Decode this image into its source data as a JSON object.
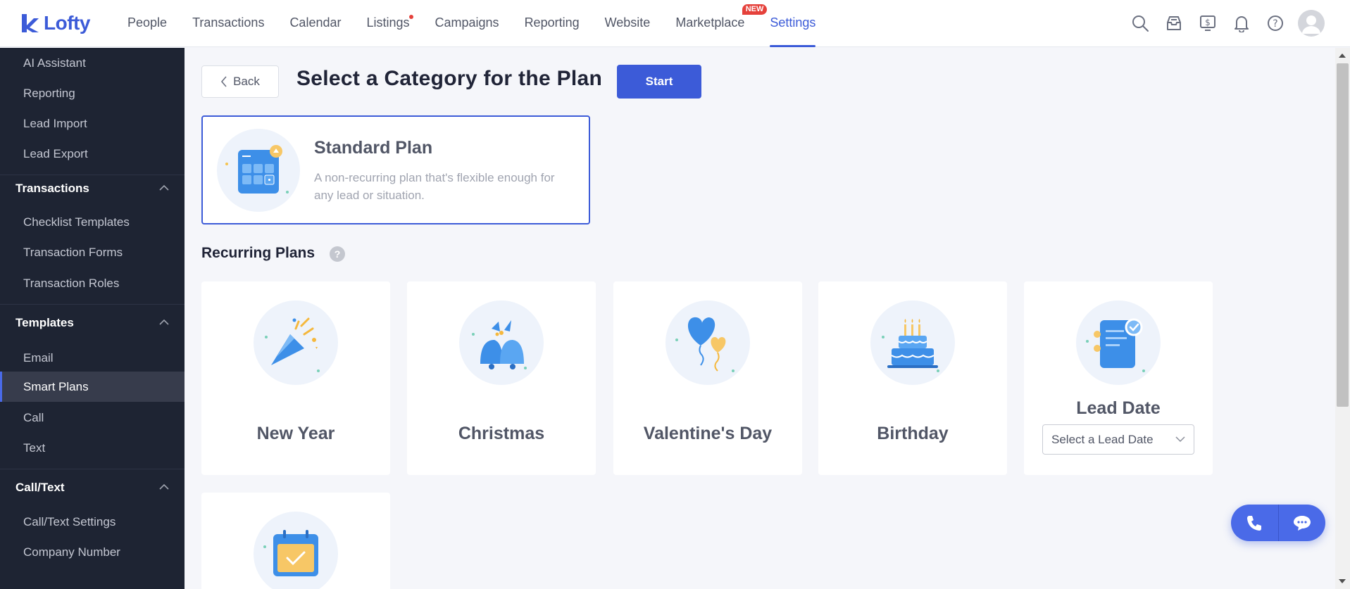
{
  "brand": {
    "name": "Lofty",
    "accent": "#3c5bd8"
  },
  "nav": {
    "items": [
      {
        "label": "People",
        "active": false
      },
      {
        "label": "Transactions",
        "active": false
      },
      {
        "label": "Calendar",
        "active": false
      },
      {
        "label": "Listings",
        "active": false,
        "dot": true
      },
      {
        "label": "Campaigns",
        "active": false
      },
      {
        "label": "Reporting",
        "active": false
      },
      {
        "label": "Website",
        "active": false
      },
      {
        "label": "Marketplace",
        "active": false,
        "badge": "NEW"
      },
      {
        "label": "Settings",
        "active": true
      }
    ],
    "icons": [
      "search-icon",
      "inbox-icon",
      "billing-icon",
      "bell-icon",
      "help-icon",
      "avatar"
    ]
  },
  "sidebar": {
    "items_top": [
      "AI Assistant",
      "Reporting",
      "Lead Import",
      "Lead Export"
    ],
    "transactions": {
      "title": "Transactions",
      "items": [
        "Checklist Templates",
        "Transaction Forms",
        "Transaction Roles"
      ]
    },
    "templates": {
      "title": "Templates",
      "items": [
        "Email",
        "Smart Plans",
        "Call",
        "Text"
      ],
      "active": "Smart Plans"
    },
    "calltext": {
      "title": "Call/Text",
      "items": [
        "Call/Text Settings",
        "Company Number"
      ]
    }
  },
  "main": {
    "back_label": "Back",
    "title": "Select a Category for the Plan",
    "start_label": "Start",
    "standard": {
      "title": "Standard Plan",
      "description": "A non-recurring plan that's flexible enough for any lead or situation."
    },
    "recurring_title": "Recurring Plans",
    "help_glyph": "?",
    "recurring": [
      {
        "label": "New Year",
        "icon": "party-popper-icon"
      },
      {
        "label": "Christmas",
        "icon": "christmas-bells-icon"
      },
      {
        "label": "Valentine's Day",
        "icon": "heart-balloons-icon"
      },
      {
        "label": "Birthday",
        "icon": "birthday-cake-icon"
      },
      {
        "label": "Lead Date",
        "icon": "document-check-icon",
        "select_placeholder": "Select a Lead Date"
      }
    ],
    "extra_card_icon": "calendar-check-icon"
  }
}
